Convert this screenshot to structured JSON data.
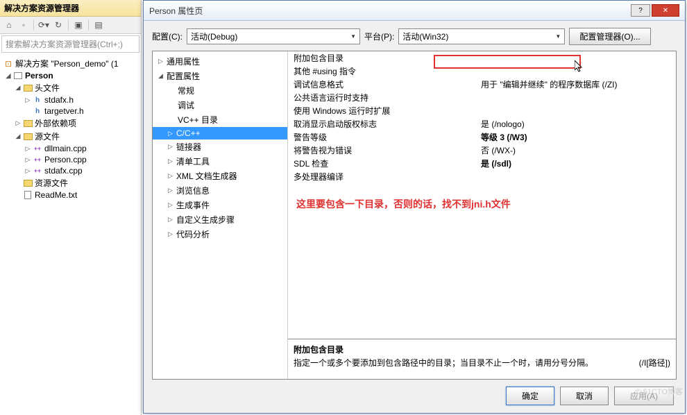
{
  "explorer": {
    "title": "解决方案资源管理器",
    "search_placeholder": "搜索解决方案资源管理器(Ctrl+;)",
    "solution": "解决方案 \"Person_demo\" (1",
    "project": "Person",
    "folders": {
      "headers": "头文件",
      "external": "外部依赖项",
      "sources": "源文件",
      "resources": "资源文件"
    },
    "files": {
      "stdafx_h": "stdafx.h",
      "targetver_h": "targetver.h",
      "dllmain_cpp": "dllmain.cpp",
      "person_cpp": "Person.cpp",
      "stdafx_cpp": "stdafx.cpp",
      "readme": "ReadMe.txt"
    }
  },
  "dialog": {
    "title": "Person 属性页",
    "config_label": "配置(C):",
    "config_value": "活动(Debug)",
    "platform_label": "平台(P):",
    "platform_value": "活动(Win32)",
    "config_mgr": "配置管理器(O)...",
    "tree": {
      "common": "通用属性",
      "config": "配置属性",
      "general": "常规",
      "debug": "调试",
      "vcdir": "VC++ 目录",
      "ccpp": "C/C++",
      "linker": "链接器",
      "manifest": "清单工具",
      "xmldoc": "XML 文档生成器",
      "browse": "浏览信息",
      "build": "生成事件",
      "custom": "自定义生成步骤",
      "code": "代码分析"
    },
    "props": [
      {
        "name": "附加包含目录",
        "val": ""
      },
      {
        "name": "其他 #using 指令",
        "val": ""
      },
      {
        "name": "调试信息格式",
        "val": "用于 \"编辑并继续\" 的程序数据库 (/ZI)"
      },
      {
        "name": "公共语言运行时支持",
        "val": ""
      },
      {
        "name": "使用 Windows 运行时扩展",
        "val": ""
      },
      {
        "name": "取消显示启动版权标志",
        "val": "是 (/nologo)"
      },
      {
        "name": "警告等级",
        "val": "等级 3 (/W3)",
        "bold": true
      },
      {
        "name": "将警告视为错误",
        "val": "否 (/WX-)"
      },
      {
        "name": "SDL 检查",
        "val": "是 (/sdl)",
        "bold": true
      },
      {
        "name": "多处理器编译",
        "val": ""
      }
    ],
    "annotation": "这里要包含一下目录，否则的话，找不到jni.h文件",
    "help": {
      "title": "附加包含目录",
      "desc": "指定一个或多个要添加到包含路径中的目录；当目录不止一个时，请用分号分隔。",
      "flag": "(/I[路径])"
    },
    "buttons": {
      "ok": "确定",
      "cancel": "取消",
      "apply": "应用(A)"
    }
  },
  "watermark": "© 51CTO博客"
}
